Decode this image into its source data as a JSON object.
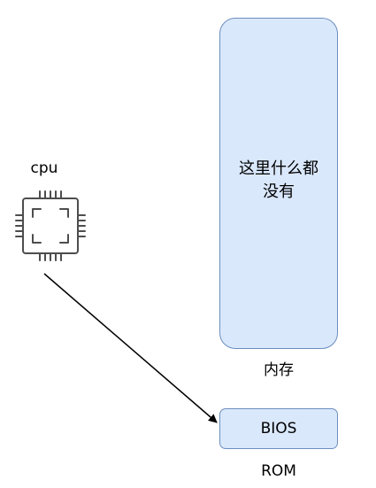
{
  "cpu": {
    "label": "cpu"
  },
  "memory": {
    "lines": [
      "这里什么都",
      "没有"
    ],
    "caption": "内存"
  },
  "bios": {
    "label": "BIOS",
    "caption": "ROM"
  },
  "colors": {
    "box_fill": "#dae8fc",
    "box_stroke": "#6c8ebf",
    "icon_stroke": "#4d4d4d",
    "arrow": "#000000"
  },
  "icons": {
    "cpu": "cpu-chip-icon"
  }
}
